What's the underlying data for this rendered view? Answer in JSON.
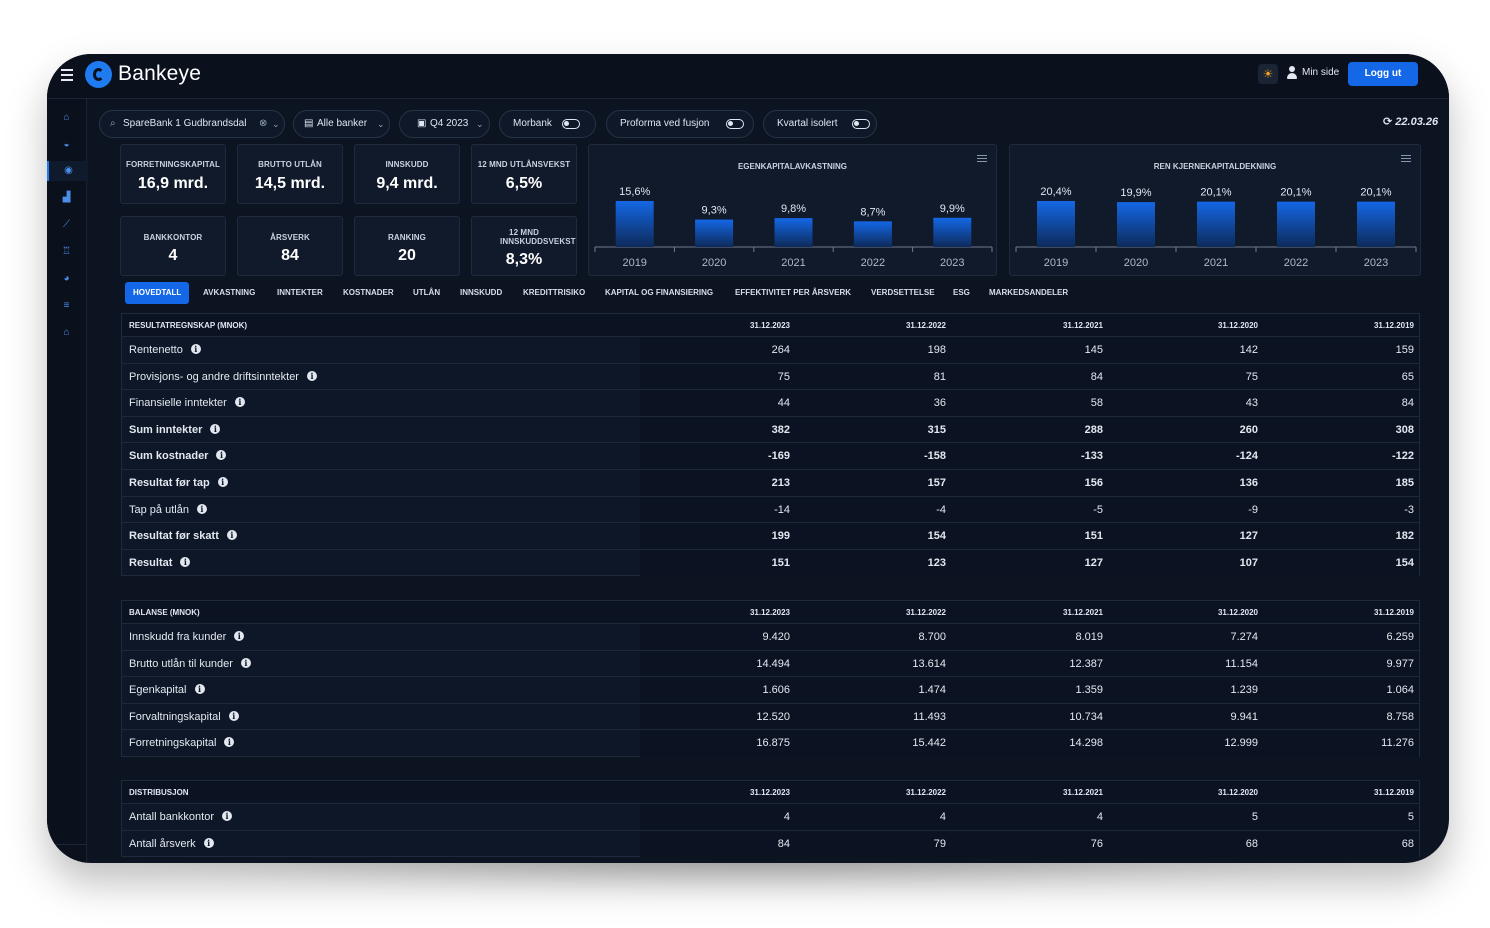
{
  "brand": "Bankeye",
  "header": {
    "min_side": "Min side",
    "logout": "Logg ut"
  },
  "filters": {
    "bank": "SpareBank 1 Gudbrandsdal",
    "group": "Alle banker",
    "period": "Q4 2023",
    "morbank": "Morbank",
    "proforma": "Proforma ved fusjon",
    "kvartal": "Kvartal isolert",
    "date": "22.03.26"
  },
  "kpis": [
    {
      "label": "FORRETNINGSKAPITAL",
      "value": "16,9 mrd."
    },
    {
      "label": "BRUTTO UTLÅN",
      "value": "14,5 mrd."
    },
    {
      "label": "INNSKUDD",
      "value": "9,4 mrd."
    },
    {
      "label": "12 MND UTLÅNSVEKST",
      "value": "6,5%"
    },
    {
      "label": "BANKKONTOR",
      "value": "4"
    },
    {
      "label": "ÅRSVERK",
      "value": "84"
    },
    {
      "label": "RANKING",
      "value": "20"
    },
    {
      "label": "12 MND INNSKUDDSVEKST",
      "value": "8,3%"
    }
  ],
  "chart_data": [
    {
      "type": "bar",
      "title": "EGENKAPITALAVKASTNING",
      "categories": [
        "2019",
        "2020",
        "2021",
        "2022",
        "2023"
      ],
      "values": [
        15.6,
        9.3,
        9.8,
        8.7,
        9.9
      ],
      "labels": [
        "15,6%",
        "9,3%",
        "9,8%",
        "8,7%",
        "9,9%"
      ],
      "color": "#1467e6"
    },
    {
      "type": "bar",
      "title": "REN KJERNEKAPITALDEKNING",
      "categories": [
        "2019",
        "2020",
        "2021",
        "2022",
        "2023"
      ],
      "values": [
        20.4,
        19.9,
        20.1,
        20.1,
        20.1
      ],
      "labels": [
        "20,4%",
        "19,9%",
        "20,1%",
        "20,1%",
        "20,1%"
      ],
      "color": "#1467e6"
    }
  ],
  "tabs": [
    "HOVEDTALL",
    "AVKASTNING",
    "INNTEKTER",
    "KOSTNADER",
    "UTLÅN",
    "INNSKUDD",
    "KREDITTRISIKO",
    "KAPITAL OG FINANSIERING",
    "EFFEKTIVITET PER ÅRSVERK",
    "VERDSETTELSE",
    "ESG",
    "MARKEDSANDELER"
  ],
  "columns": [
    "31.12.2023",
    "31.12.2022",
    "31.12.2021",
    "31.12.2020",
    "31.12.2019"
  ],
  "tables": [
    {
      "title": "RESULTATREGNSKAP (MNOK)",
      "rows": [
        {
          "label": "Rentenetto",
          "bold": false,
          "values": [
            "264",
            "198",
            "145",
            "142",
            "159"
          ]
        },
        {
          "label": "Provisjons- og andre driftsinntekter",
          "bold": false,
          "values": [
            "75",
            "81",
            "84",
            "75",
            "65"
          ]
        },
        {
          "label": "Finansielle inntekter",
          "bold": false,
          "values": [
            "44",
            "36",
            "58",
            "43",
            "84"
          ]
        },
        {
          "label": "Sum inntekter",
          "bold": true,
          "values": [
            "382",
            "315",
            "288",
            "260",
            "308"
          ]
        },
        {
          "label": "Sum kostnader",
          "bold": true,
          "values": [
            "-169",
            "-158",
            "-133",
            "-124",
            "-122"
          ]
        },
        {
          "label": "Resultat før tap",
          "bold": true,
          "values": [
            "213",
            "157",
            "156",
            "136",
            "185"
          ]
        },
        {
          "label": "Tap på utlån",
          "bold": false,
          "values": [
            "-14",
            "-4",
            "-5",
            "-9",
            "-3"
          ]
        },
        {
          "label": "Resultat før skatt",
          "bold": true,
          "values": [
            "199",
            "154",
            "151",
            "127",
            "182"
          ]
        },
        {
          "label": "Resultat",
          "bold": true,
          "values": [
            "151",
            "123",
            "127",
            "107",
            "154"
          ]
        }
      ]
    },
    {
      "title": "BALANSE (MNOK)",
      "rows": [
        {
          "label": "Innskudd fra kunder",
          "bold": false,
          "values": [
            "9.420",
            "8.700",
            "8.019",
            "7.274",
            "6.259"
          ]
        },
        {
          "label": "Brutto utlån til kunder",
          "bold": false,
          "values": [
            "14.494",
            "13.614",
            "12.387",
            "11.154",
            "9.977"
          ]
        },
        {
          "label": "Egenkapital",
          "bold": false,
          "values": [
            "1.606",
            "1.474",
            "1.359",
            "1.239",
            "1.064"
          ]
        },
        {
          "label": "Forvaltningskapital",
          "bold": false,
          "values": [
            "12.520",
            "11.493",
            "10.734",
            "9.941",
            "8.758"
          ]
        },
        {
          "label": "Forretningskapital",
          "bold": false,
          "values": [
            "16.875",
            "15.442",
            "14.298",
            "12.999",
            "11.276"
          ]
        }
      ]
    },
    {
      "title": "DISTRIBUSJON",
      "rows": [
        {
          "label": "Antall bankkontor",
          "bold": false,
          "values": [
            "4",
            "4",
            "4",
            "5",
            "5"
          ]
        },
        {
          "label": "Antall årsverk",
          "bold": false,
          "values": [
            "84",
            "79",
            "76",
            "68",
            "68"
          ]
        }
      ]
    }
  ]
}
